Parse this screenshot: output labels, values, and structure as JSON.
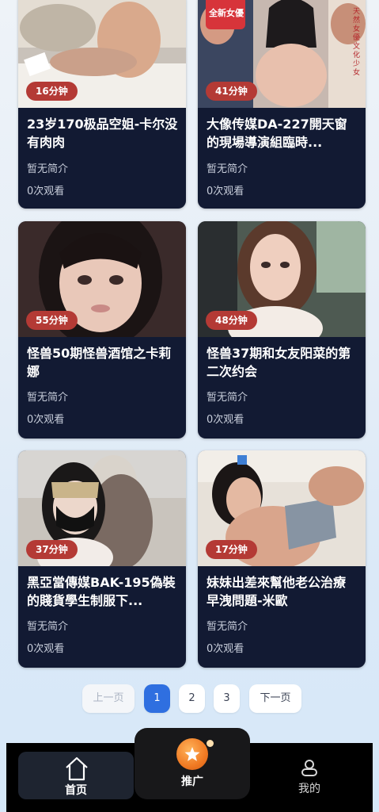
{
  "videos": [
    {
      "duration": "16分钟",
      "title": "23岁170极品空姐-卡尔没有肉肉",
      "intro": "暂无简介",
      "views": "0次观看"
    },
    {
      "duration": "41分钟",
      "title": "大像传媒DA-227開天窗的現場導演組臨時...",
      "intro": "暂无简介",
      "views": "0次观看"
    },
    {
      "duration": "55分钟",
      "title": "怪兽50期怪兽酒馆之卡莉娜",
      "intro": "暂无简介",
      "views": "0次观看"
    },
    {
      "duration": "48分钟",
      "title": "怪兽37期和女友阳菜的第二次约会",
      "intro": "暂无简介",
      "views": "0次观看"
    },
    {
      "duration": "37分钟",
      "title": "黑亞當傳媒BAK-195偽裝的賤貨學生制服下...",
      "intro": "暂无简介",
      "views": "0次观看"
    },
    {
      "duration": "17分钟",
      "title": "妹妹出差來幫他老公治療早洩問題-米歐",
      "intro": "暂无简介",
      "views": "0次观看"
    }
  ],
  "thumb_text": {
    "badge_line1": "全新女優",
    "side_text": "天然女優文化少女"
  },
  "pagination": {
    "prev": "上一页",
    "pages": [
      "1",
      "2",
      "3"
    ],
    "current": "1",
    "next": "下一页"
  },
  "tabbar": {
    "home": "首页",
    "promo": "推广",
    "mine": "我的"
  },
  "colors": {
    "card": "#121a33",
    "duration_badge": "#b43a35",
    "active_page": "#2f6fe0",
    "promo": "#f07a23"
  }
}
